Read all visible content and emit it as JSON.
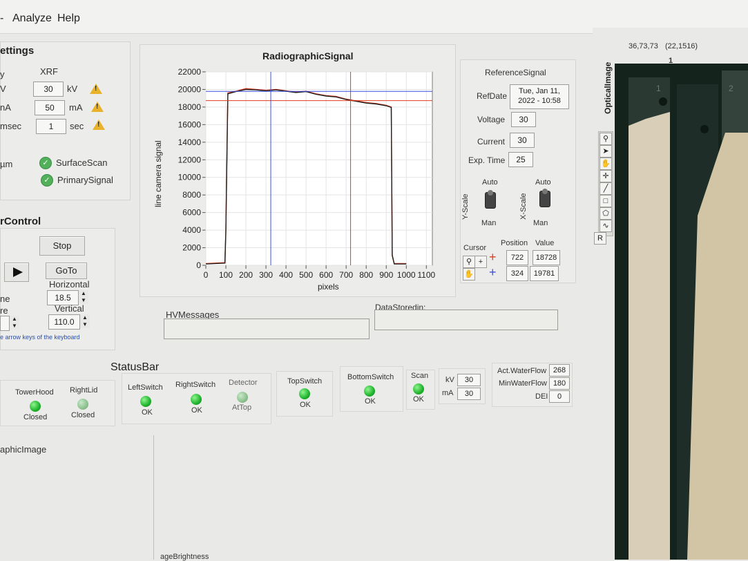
{
  "menu": {
    "analyze": "Analyze",
    "help": "Help"
  },
  "settings": {
    "title": "ettings",
    "column_header": "XRF",
    "rows": [
      {
        "label": "y",
        "value": "",
        "unit": ""
      },
      {
        "label": "V",
        "value": "30",
        "unit": "kV"
      },
      {
        "label": "nA",
        "value": "50",
        "unit": "mA"
      },
      {
        "label": "msec",
        "value": "1",
        "unit": "sec"
      }
    ],
    "micron_label": "µm",
    "surface_scan": "SurfaceScan",
    "primary_signal": "PrimarySignal"
  },
  "control": {
    "title": "rControl",
    "stop_label": "Stop",
    "goto_label": "GoTo",
    "horizontal_label": "Horizontal",
    "horizontal_value": "18.5",
    "vertical_label": "Vertical",
    "vertical_value": "110.0",
    "ne_label": "ne",
    "re_label": "re",
    "hint": "e arrow keys of the keyboard"
  },
  "chart": {
    "title": "RadiographicSignal",
    "ylabel": "line camera signal",
    "xlabel": "pixels",
    "yticks": [
      "22000",
      "20000",
      "18000",
      "16000",
      "14000",
      "12000",
      "10000",
      "8000",
      "6000",
      "4000",
      "2000",
      "0"
    ],
    "xticks": [
      "0",
      "100",
      "200",
      "300",
      "400",
      "500",
      "600",
      "700",
      "800",
      "900",
      "1000",
      "1100"
    ]
  },
  "chart_data": {
    "type": "line",
    "title": "RadiographicSignal",
    "xlabel": "pixels",
    "ylabel": "line camera signal",
    "xlim": [
      0,
      1130
    ],
    "ylim": [
      0,
      22000
    ],
    "grid": true,
    "series": [
      {
        "color": "#e23a1c",
        "x": [
          0,
          95,
          100,
          110,
          150,
          200,
          250,
          300,
          350,
          400,
          450,
          500,
          550,
          600,
          650,
          700,
          750,
          800,
          850,
          900,
          925,
          930,
          940,
          960,
          1000
        ],
        "values": [
          200,
          300,
          4000,
          19600,
          19800,
          20100,
          20000,
          19900,
          20000,
          19850,
          19700,
          19800,
          19500,
          19300,
          19200,
          18900,
          18700,
          18500,
          18400,
          18200,
          18000,
          1200,
          200,
          200,
          200
        ]
      },
      {
        "color": "#222222",
        "x": [
          0,
          95,
          100,
          110,
          150,
          200,
          250,
          300,
          350,
          400,
          450,
          500,
          550,
          600,
          650,
          700,
          750,
          800,
          850,
          900,
          925,
          930,
          940,
          960,
          1000
        ],
        "values": [
          150,
          250,
          3800,
          19500,
          19750,
          20000,
          19950,
          19850,
          19950,
          19800,
          19650,
          19750,
          19450,
          19250,
          19150,
          18850,
          18650,
          18450,
          18350,
          18150,
          17950,
          1100,
          150,
          150,
          150
        ]
      }
    ],
    "cursors": [
      {
        "color": "#e23a1c",
        "x": 722,
        "y": 18728
      },
      {
        "color": "#3a4fe0",
        "x": 324,
        "y": 19781
      }
    ]
  },
  "reference": {
    "title": "ReferenceSignal",
    "refdate_label": "RefDate",
    "refdate_value_1": "Tue, Jan 11,",
    "refdate_value_2": "2022 - 10:58",
    "voltage_label": "Voltage",
    "voltage_value": "30",
    "current_label": "Current",
    "current_value": "30",
    "exptime_label": "Exp. Time",
    "exptime_value": "25",
    "yscale_label": "Y-Scale",
    "xscale_label": "X-Scale",
    "auto_label": "Auto",
    "man_label": "Man",
    "cursor_label": "Cursor",
    "position_label": "Position",
    "value_label": "Value",
    "cursor1_position": "722",
    "cursor1_value": "18728",
    "cursor2_position": "324",
    "cursor2_value": "19781"
  },
  "messages": {
    "hv_label": "HVMessages",
    "data_stored_label": "DataStoredin:"
  },
  "status": {
    "title": "StatusBar",
    "items": [
      {
        "name": "TowerHood",
        "state": "Closed"
      },
      {
        "name": "RightLid",
        "state": "Closed"
      },
      {
        "name": "LeftSwitch",
        "state": "OK"
      },
      {
        "name": "RightSwitch",
        "state": "OK"
      },
      {
        "name": "Detector",
        "state": "AtTop"
      },
      {
        "name": "TopSwitch",
        "state": "OK"
      },
      {
        "name": "BottomSwitch",
        "state": "OK"
      },
      {
        "name": "Scan",
        "state": "OK"
      }
    ],
    "kv_label": "kV",
    "kv_value": "30",
    "ma_label": "mA",
    "ma_value": "30",
    "act_waterflow_label": "Act.WaterFlow",
    "act_waterflow_value": "268",
    "min_waterflow_label": "MinWaterFlow",
    "min_waterflow_value": "180",
    "dei_label": "DEI",
    "dei_value": "0"
  },
  "bottom": {
    "graphic_image_label": "aphicImage",
    "image_brightness_label": "ageBrightness"
  },
  "optical": {
    "title": "OpticalImage",
    "coords": "36,73,73",
    "coords2": "(22,1516)",
    "column_1": "1",
    "reset_label": "R"
  },
  "icons": [
    "warning-icon",
    "check-icon",
    "play-icon",
    "zoom-icon",
    "pointer-icon",
    "hand-icon",
    "crosshair-icon",
    "line-icon",
    "rectangle-icon",
    "polygon-icon",
    "freehand-icon"
  ]
}
